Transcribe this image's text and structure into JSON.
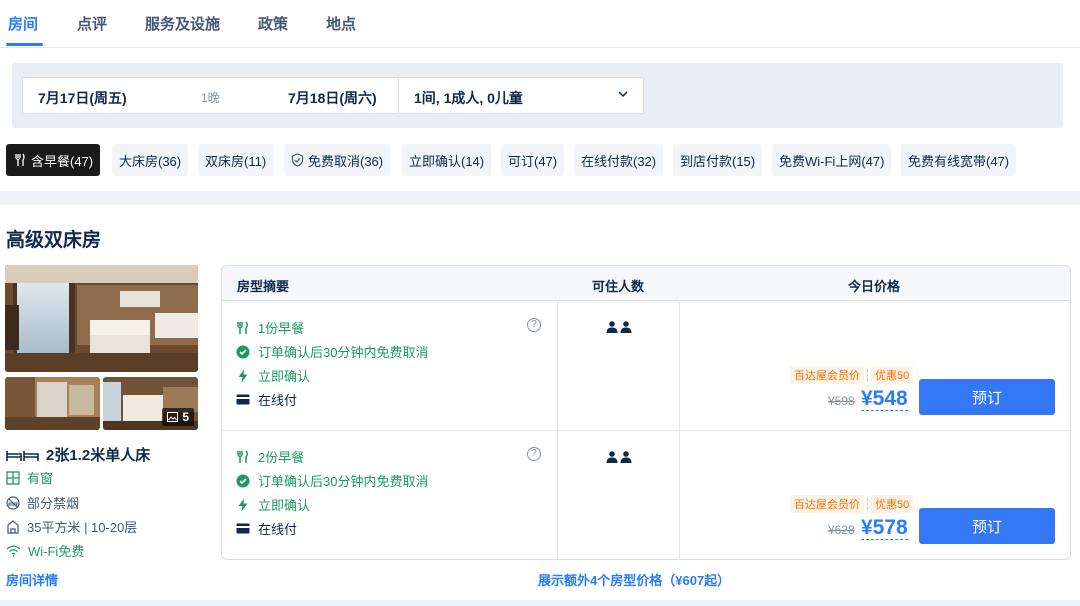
{
  "tabs": [
    {
      "label": "房间"
    },
    {
      "label": "点评"
    },
    {
      "label": "服务及设施"
    },
    {
      "label": "政策"
    },
    {
      "label": "地点"
    }
  ],
  "search": {
    "checkin": "7月17日(周五)",
    "nights": "1晚",
    "checkout": "7月18日(周六)",
    "guests": "1间, 1成人, 0儿童"
  },
  "filters": [
    {
      "label": "含早餐(47)",
      "icon": "fork-knife-icon",
      "active": true
    },
    {
      "label": "大床房(36)"
    },
    {
      "label": "双床房(11)"
    },
    {
      "label": "免费取消(36)",
      "icon": "shield-icon"
    },
    {
      "label": "立即确认(14)"
    },
    {
      "label": "可订(47)"
    },
    {
      "label": "在线付款(32)"
    },
    {
      "label": "到店付款(15)"
    },
    {
      "label": "免费Wi-Fi上网(47)"
    },
    {
      "label": "免费有线宽带(47)"
    }
  ],
  "room": {
    "title": "高级双床房",
    "photo_count": "5",
    "bed": "2张1.2米单人床",
    "window": "有窗",
    "smoking": "部分禁烟",
    "size": "35平方米 | 10-20层",
    "wifi": "Wi-Fi免费",
    "details_link": "房间详情"
  },
  "table": {
    "headers": {
      "summary": "房型摘要",
      "occupancy": "可住人数",
      "price": "今日价格"
    },
    "rows": [
      {
        "breakfast": "1份早餐",
        "cancel": "订单确认后30分钟内免费取消",
        "confirm": "立即确认",
        "payment": "在线付",
        "member_tag": "百达屋会员价",
        "discount": "优惠50",
        "old_price": "¥598",
        "price": "¥548",
        "book": "预订"
      },
      {
        "breakfast": "2份早餐",
        "cancel": "订单确认后30分钟内免费取消",
        "confirm": "立即确认",
        "payment": "在线付",
        "member_tag": "百达屋会员价",
        "discount": "优惠50",
        "old_price": "¥628",
        "price": "¥578",
        "book": "预订"
      }
    ],
    "more_link": "展示额外4个房型价格（¥607起）"
  },
  "colors": {
    "accent": "#287dfa",
    "green": "#1b9b5e",
    "orange": "#ff6f00",
    "button": "#3478f6"
  }
}
